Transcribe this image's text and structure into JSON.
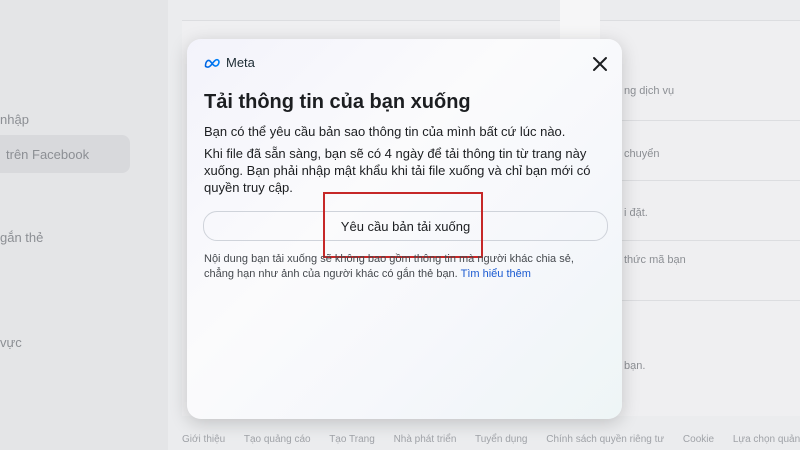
{
  "background": {
    "left_items": [
      "nhập",
      "trên Facebook",
      "gắn thẻ",
      "vực"
    ],
    "right_items": [
      "ng dịch vụ",
      "chuyển",
      "i đặt.",
      "thức mã bạn",
      "bạn."
    ]
  },
  "footer": {
    "links": [
      "Giới thiệu",
      "Tạo quảng cáo",
      "Tạo Trang",
      "Nhà phát triển",
      "Tuyển dụng",
      "Chính sách quyền riêng tư",
      "Cookie",
      "Lựa chọn quảng cáo"
    ]
  },
  "modal": {
    "brand": "Meta",
    "title": "Tải thông tin của bạn xuống",
    "paragraph1": "Bạn có thể yêu cầu bản sao thông tin của mình bất cứ lúc nào.",
    "paragraph2": "Khi file đã sẵn sàng, bạn sẽ có 4 ngày để tải thông tin từ trang này xuống. Bạn phải nhập mật khẩu khi tải file xuống và chỉ bạn mới có quyền truy cập.",
    "request_button": "Yêu cầu bản tải xuống",
    "note": "Nội dung bạn tải xuống sẽ không bao gồm thông tin mà người khác chia sẻ, chẳng hạn như ảnh của người khác có gắn thẻ bạn.",
    "learn_more": "Tìm hiểu thêm"
  },
  "colors": {
    "highlight_box": "#c62828",
    "link": "#1a5ad1"
  },
  "icons": [
    "meta-logo-icon",
    "close-icon"
  ]
}
